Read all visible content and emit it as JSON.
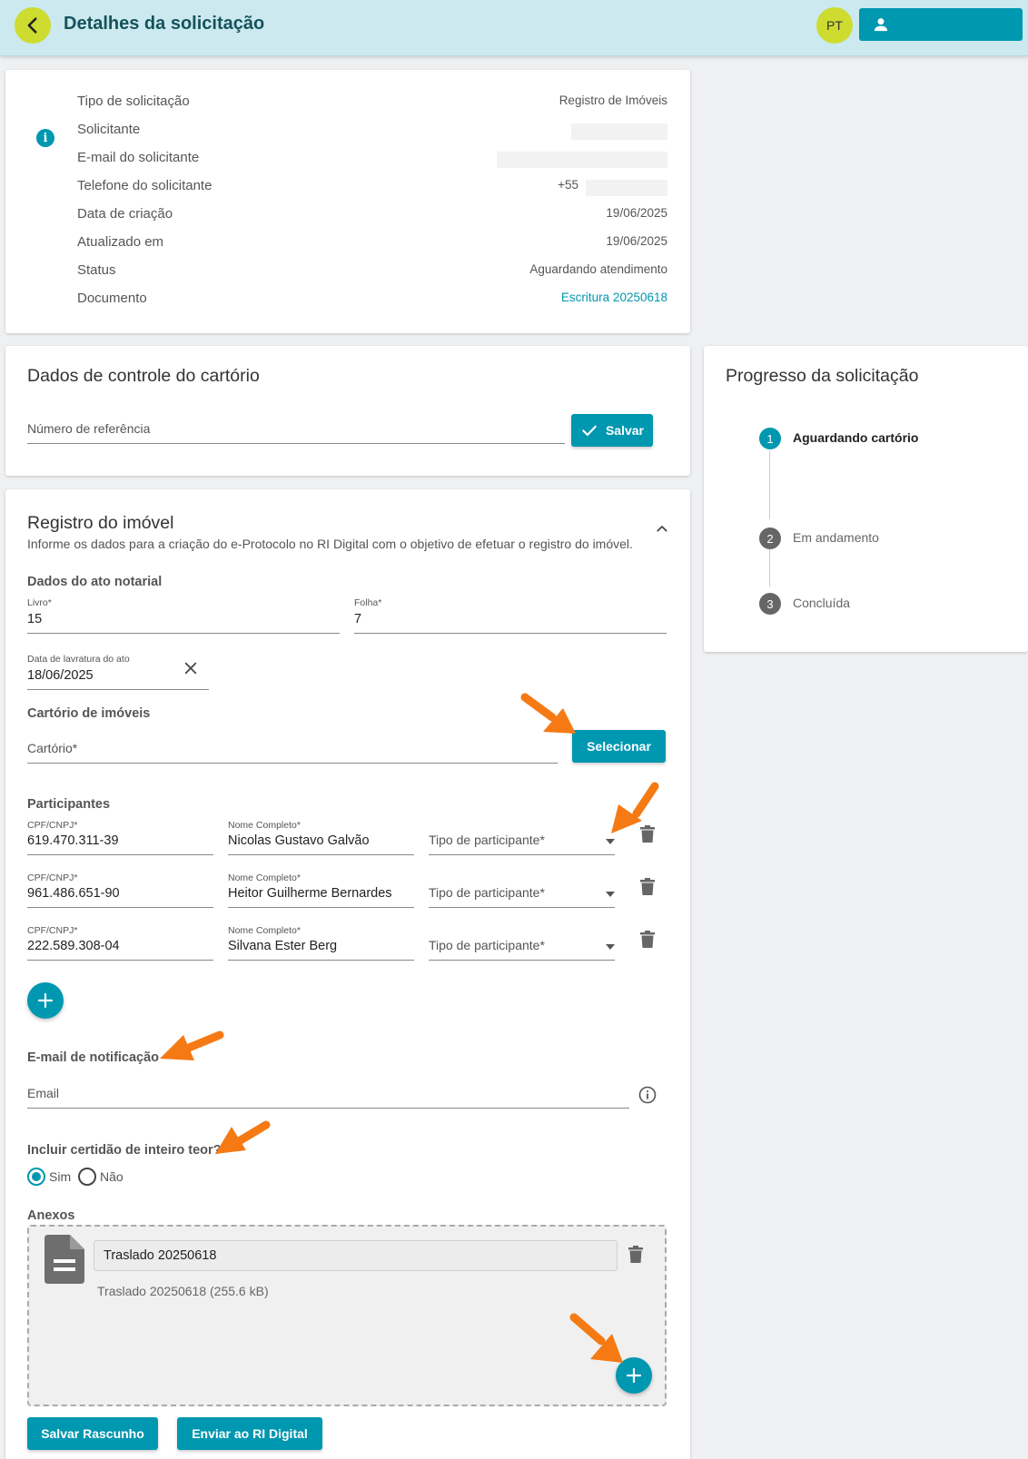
{
  "header": {
    "title": "Detalhes da solicitação",
    "avatar": "PT",
    "back_icon": "chevron-left-icon",
    "user_icon": "person-icon"
  },
  "details": {
    "rows": [
      {
        "label": "Tipo de solicitação",
        "value": "Registro de Imóveis"
      },
      {
        "label": "Solicitante",
        "value": ""
      },
      {
        "label": "E-mail do solicitante",
        "value": ""
      },
      {
        "label": "Telefone do solicitante",
        "value": "+55"
      },
      {
        "label": "Data de criação",
        "value": "19/06/2025"
      },
      {
        "label": "Atualizado em",
        "value": "19/06/2025"
      },
      {
        "label": "Status",
        "value": "Aguardando atendimento"
      },
      {
        "label": "Documento",
        "value": "Escritura 20250618"
      }
    ],
    "info_icon": "i"
  },
  "control": {
    "title": "Dados de controle do cartório",
    "ref_placeholder": "Número de referência",
    "save_label": "Salvar"
  },
  "progress": {
    "title": "Progresso da solicitação",
    "steps": [
      {
        "num": "1",
        "label": "Aguardando cartório"
      },
      {
        "num": "2",
        "label": "Em andamento"
      },
      {
        "num": "3",
        "label": "Concluída"
      }
    ]
  },
  "registro": {
    "title": "Registro do imóvel",
    "subtitle": "Informe os dados para a criação do e-Protocolo no RI Digital com o objetivo de efetuar o registro do imóvel.",
    "ato_head": "Dados do ato notarial",
    "livro_label": "Livro*",
    "livro_value": "15",
    "folha_label": "Folha*",
    "folha_value": "7",
    "data_label": "Data de lavratura do ato",
    "data_value": "18/06/2025",
    "cartorio_head": "Cartório de imóveis",
    "cartorio_placeholder": "Cartório*",
    "selecionar_label": "Selecionar",
    "participantes_head": "Participantes",
    "cpf_label": "CPF/CNPJ*",
    "nome_label": "Nome Completo*",
    "tipo_placeholder": "Tipo de participante*",
    "participants": [
      {
        "cpf": "619.470.311-39",
        "nome": "Nicolas Gustavo Galvão"
      },
      {
        "cpf": "961.486.651-90",
        "nome": "Heitor Guilherme Bernardes"
      },
      {
        "cpf": "222.589.308-04",
        "nome": "Silvana Ester Berg"
      }
    ],
    "email_head": "E-mail de notificação",
    "email_placeholder": "Email",
    "certidao_head": "Incluir certidão de inteiro teor?",
    "sim": "Sim",
    "nao": "Não",
    "anexos_head": "Anexos",
    "anexo_name": "Traslado 20250618",
    "anexo_meta": "Traslado 20250618 (255.6 kB)",
    "salvar_rascunho": "Salvar Rascunho",
    "enviar": "Enviar ao RI Digital"
  },
  "colors": {
    "accent": "#0097b0",
    "header_bg": "#cbe9ee",
    "avatar_bg": "#cddc2f",
    "arrow": "#f57a14"
  }
}
